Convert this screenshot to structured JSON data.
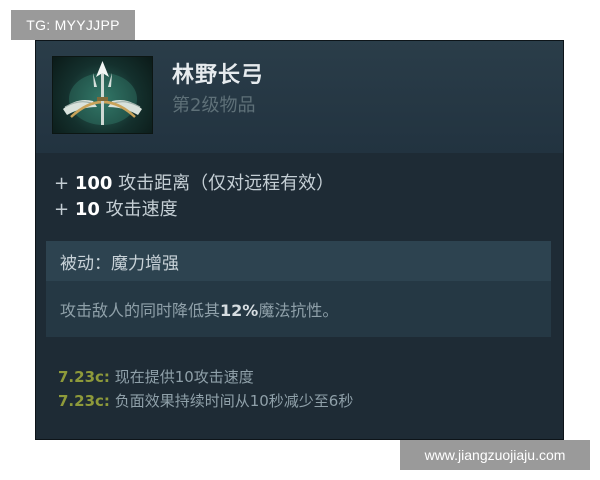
{
  "watermarks": {
    "top_left": "TG: MYYJJPP",
    "bottom_right": "www.jiangzuojiaju.com"
  },
  "item": {
    "name": "林野长弓",
    "tier": "第2级物品",
    "icon": "dragon-lance-icon"
  },
  "stats": [
    {
      "prefix": "+",
      "value": "100",
      "label": "攻击距离（仅对远程有效）"
    },
    {
      "prefix": "+",
      "value": "10",
      "label": "攻击速度"
    }
  ],
  "passive": {
    "title": "被动：魔力增强",
    "desc_before": "攻击敌人的同时降低其",
    "desc_highlight": "12%",
    "desc_after": "魔法抗性。"
  },
  "notes": [
    {
      "version": "7.23c:",
      "text": "现在提供10攻击速度"
    },
    {
      "version": "7.23c:",
      "text": "负面效果持续时间从10秒减少至6秒"
    }
  ],
  "colors": {
    "panel_bg": "#1e2b35",
    "header_bg": "#2a3d49",
    "passive_header_bg": "#2d4350",
    "version_text": "#8e9a3a",
    "watermark_bg": "#9a9a9a"
  }
}
